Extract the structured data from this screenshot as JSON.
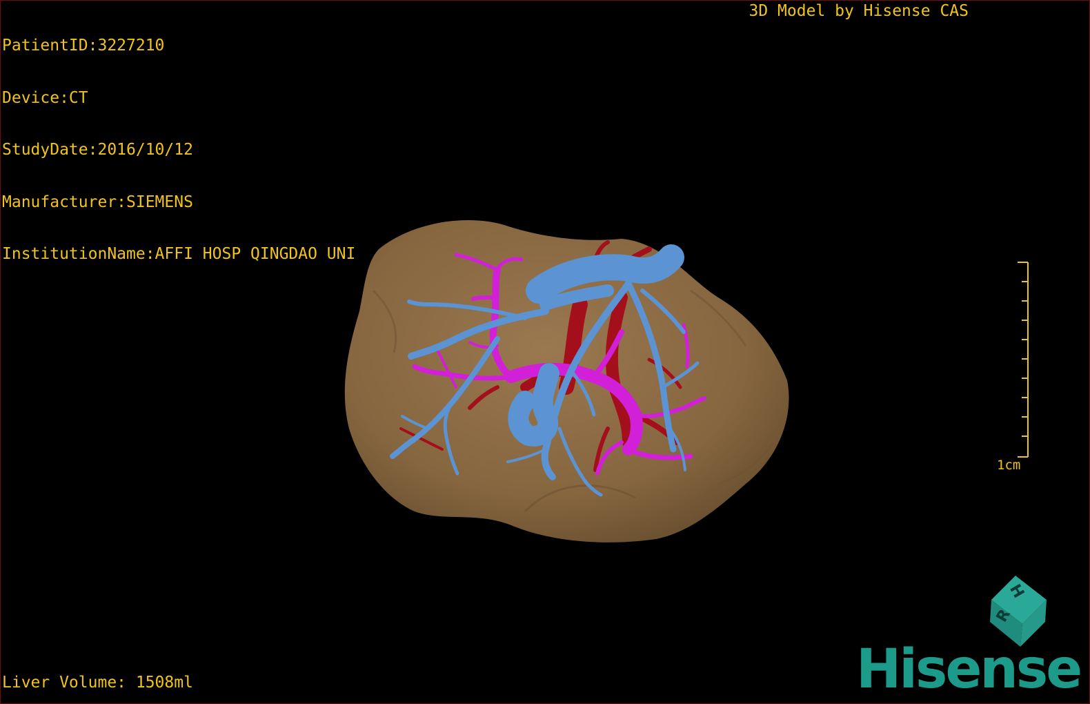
{
  "window": {
    "title": "3D Model by Hisense CAS"
  },
  "patient_info": {
    "patient_id": "PatientID:3227210",
    "device": "Device:CT",
    "study_date": "StudyDate:2016/10/12",
    "manufacturer": "Manufacturer:SIEMENS",
    "institution": "InstitutionName:AFFI HOSP QINGDAO UNI"
  },
  "measurements": {
    "liver_volume": "Liver Volume: 1508ml"
  },
  "scale_bar": {
    "label": "1cm"
  },
  "orientation_cube": {
    "faces": [
      "H",
      "R"
    ]
  },
  "brand": {
    "logo_text": "Hisense"
  },
  "colors": {
    "overlay_text": "#f0c419",
    "liver": "#8a6a45",
    "hepatic_vein": "#5b93d3",
    "portal_vein": "#d21fd8",
    "artery": "#a3101c",
    "brand": "#1d9b8a"
  }
}
